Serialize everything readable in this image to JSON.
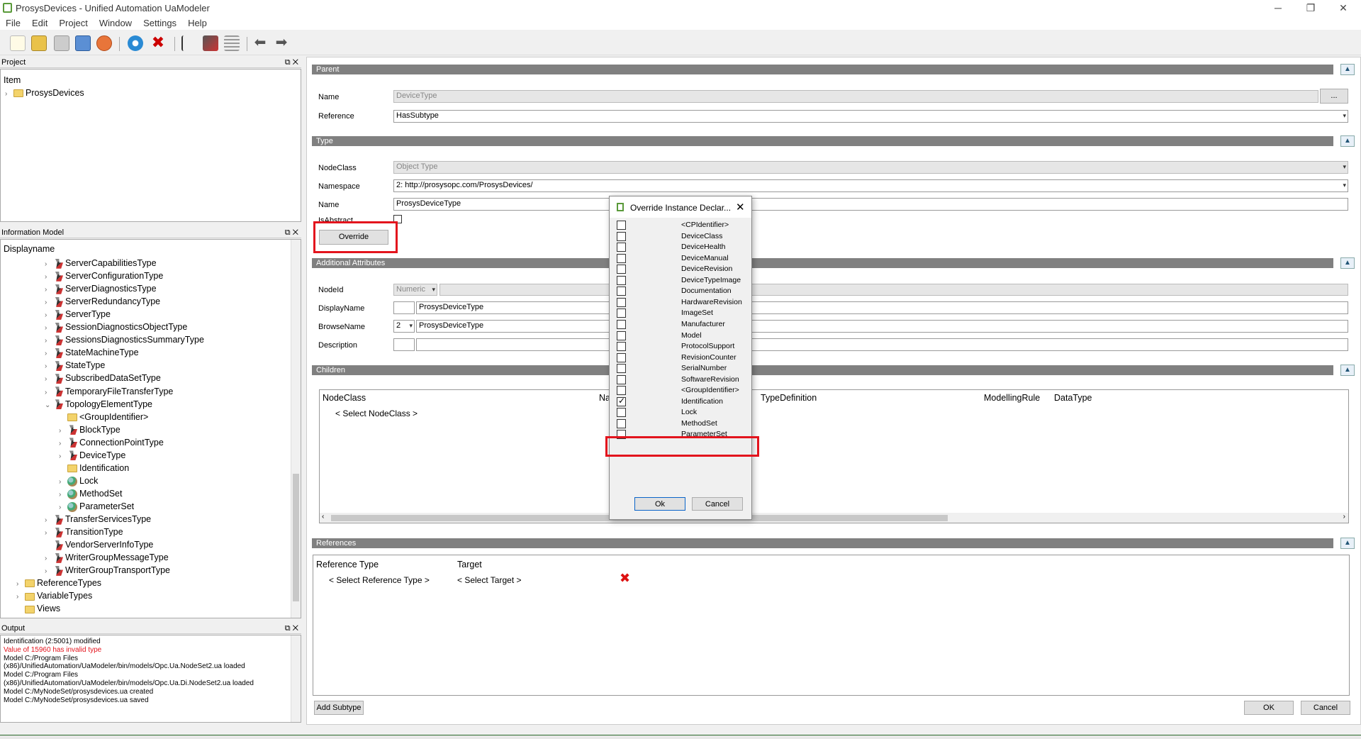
{
  "window": {
    "title": "ProsysDevices - Unified Automation UaModeler"
  },
  "menu": [
    "File",
    "Edit",
    "Project",
    "Window",
    "Settings",
    "Help"
  ],
  "project_panel": {
    "title": "Project",
    "column": "Item",
    "root": "ProsysDevices"
  },
  "info_panel": {
    "title": "Information Model",
    "column": "Displayname",
    "items": [
      {
        "label": "ServerCapabilitiesType",
        "level": 3,
        "icon": "type"
      },
      {
        "label": "ServerConfigurationType",
        "level": 3,
        "icon": "type"
      },
      {
        "label": "ServerDiagnosticsType",
        "level": 3,
        "icon": "type"
      },
      {
        "label": "ServerRedundancyType",
        "level": 3,
        "icon": "type"
      },
      {
        "label": "ServerType",
        "level": 3,
        "icon": "type"
      },
      {
        "label": "SessionDiagnosticsObjectType",
        "level": 3,
        "icon": "type"
      },
      {
        "label": "SessionsDiagnosticsSummaryType",
        "level": 3,
        "icon": "type"
      },
      {
        "label": "StateMachineType",
        "level": 3,
        "icon": "type"
      },
      {
        "label": "StateType",
        "level": 3,
        "icon": "type"
      },
      {
        "label": "SubscribedDataSetType",
        "level": 3,
        "icon": "type"
      },
      {
        "label": "TemporaryFileTransferType",
        "level": 3,
        "icon": "type"
      },
      {
        "label": "TopologyElementType",
        "level": 3,
        "icon": "type",
        "expanded": true
      },
      {
        "label": "<GroupIdentifier>",
        "level": 4,
        "icon": "folder",
        "noarrow": true
      },
      {
        "label": "BlockType",
        "level": 4,
        "icon": "type"
      },
      {
        "label": "ConnectionPointType",
        "level": 4,
        "icon": "type"
      },
      {
        "label": "DeviceType",
        "level": 4,
        "icon": "type",
        "selected": true
      },
      {
        "label": "Identification",
        "level": 4,
        "icon": "folder",
        "noarrow": true
      },
      {
        "label": "Lock",
        "level": 4,
        "icon": "obj"
      },
      {
        "label": "MethodSet",
        "level": 4,
        "icon": "obj"
      },
      {
        "label": "ParameterSet",
        "level": 4,
        "icon": "obj"
      },
      {
        "label": "TransferServicesType",
        "level": 3,
        "icon": "type"
      },
      {
        "label": "TransitionType",
        "level": 3,
        "icon": "type"
      },
      {
        "label": "VendorServerInfoType",
        "level": 3,
        "icon": "type",
        "noarrow": true
      },
      {
        "label": "WriterGroupMessageType",
        "level": 3,
        "icon": "type"
      },
      {
        "label": "WriterGroupTransportType",
        "level": 3,
        "icon": "type"
      },
      {
        "label": "ReferenceTypes",
        "level": 1,
        "icon": "folder"
      },
      {
        "label": "VariableTypes",
        "level": 1,
        "icon": "folder"
      },
      {
        "label": "Views",
        "level": 1,
        "icon": "folder",
        "noarrow": true
      }
    ]
  },
  "output_panel": {
    "title": "Output",
    "lines": [
      {
        "text": "Identification (2:5001) modified",
        "error": false
      },
      {
        "text": "Value of 15960 has invalid type",
        "error": true
      },
      {
        "text": "Model C:/Program Files",
        "error": false
      },
      {
        "text": "(x86)/UnifiedAutomation/UaModeler/bin/models/Opc.Ua.NodeSet2.ua loaded",
        "error": false
      },
      {
        "text": "Model C:/Program Files",
        "error": false
      },
      {
        "text": "(x86)/UnifiedAutomation/UaModeler/bin/models/Opc.Ua.Di.NodeSet2.ua loaded",
        "error": false
      },
      {
        "text": "Model C:/MyNodeSet/prosysdevices.ua created",
        "error": false
      },
      {
        "text": "Model C:/MyNodeSet/prosysdevices.ua saved",
        "error": false
      }
    ]
  },
  "parent": {
    "header": "Parent",
    "name_label": "Name",
    "name_value": "DeviceType",
    "browse": "...",
    "ref_label": "Reference",
    "ref_value": "HasSubtype"
  },
  "type": {
    "header": "Type",
    "nodeclass_label": "NodeClass",
    "nodeclass_value": "Object Type",
    "namespace_label": "Namespace",
    "namespace_value": "2: http://prosysopc.com/ProsysDevices/",
    "name_label": "Name",
    "name_value": "ProsysDeviceType",
    "isabstract_label": "IsAbstract",
    "override": "Override"
  },
  "additional": {
    "header": "Additional Attributes",
    "nodeid_label": "NodeId",
    "nodeid_type": "Numeric",
    "displayname_label": "DisplayName",
    "displayname_value": "ProsysDeviceType",
    "browsename_label": "BrowseName",
    "browsename_ns": "2",
    "browsename_value": "ProsysDeviceType",
    "description_label": "Description"
  },
  "children": {
    "header": "Children",
    "columns": [
      "NodeClass",
      "Na",
      "TypeDefinition",
      "ModellingRule",
      "DataType"
    ],
    "select": "< Select NodeClass >"
  },
  "references": {
    "header": "References",
    "col_type": "Reference Type",
    "col_target": "Target",
    "select_type": "< Select Reference Type >",
    "select_target": "< Select Target >"
  },
  "footer": {
    "add_subtype": "Add Subtype",
    "ok": "OK",
    "cancel": "Cancel"
  },
  "dialog": {
    "title": "Override Instance Declar...",
    "items": [
      {
        "label": "<CPIdentifier>",
        "checked": false
      },
      {
        "label": "DeviceClass",
        "checked": false
      },
      {
        "label": "DeviceHealth",
        "checked": false
      },
      {
        "label": "DeviceManual",
        "checked": false
      },
      {
        "label": "DeviceRevision",
        "checked": false
      },
      {
        "label": "DeviceTypeImage",
        "checked": false
      },
      {
        "label": "Documentation",
        "checked": false
      },
      {
        "label": "HardwareRevision",
        "checked": false
      },
      {
        "label": "ImageSet",
        "checked": false
      },
      {
        "label": "Manufacturer",
        "checked": false
      },
      {
        "label": "Model",
        "checked": false
      },
      {
        "label": "ProtocolSupport",
        "checked": false
      },
      {
        "label": "RevisionCounter",
        "checked": false
      },
      {
        "label": "SerialNumber",
        "checked": false
      },
      {
        "label": "SoftwareRevision",
        "checked": false
      },
      {
        "label": "<GroupIdentifier>",
        "checked": false
      },
      {
        "label": "Identification",
        "checked": true
      },
      {
        "label": "Lock",
        "checked": false
      },
      {
        "label": "MethodSet",
        "checked": false
      },
      {
        "label": "ParameterSet",
        "checked": false
      }
    ],
    "ok": "Ok",
    "cancel": "Cancel"
  },
  "colors": {
    "highlight": "#e3141d",
    "section_header": "#808080",
    "error_text": "#e3141d"
  }
}
